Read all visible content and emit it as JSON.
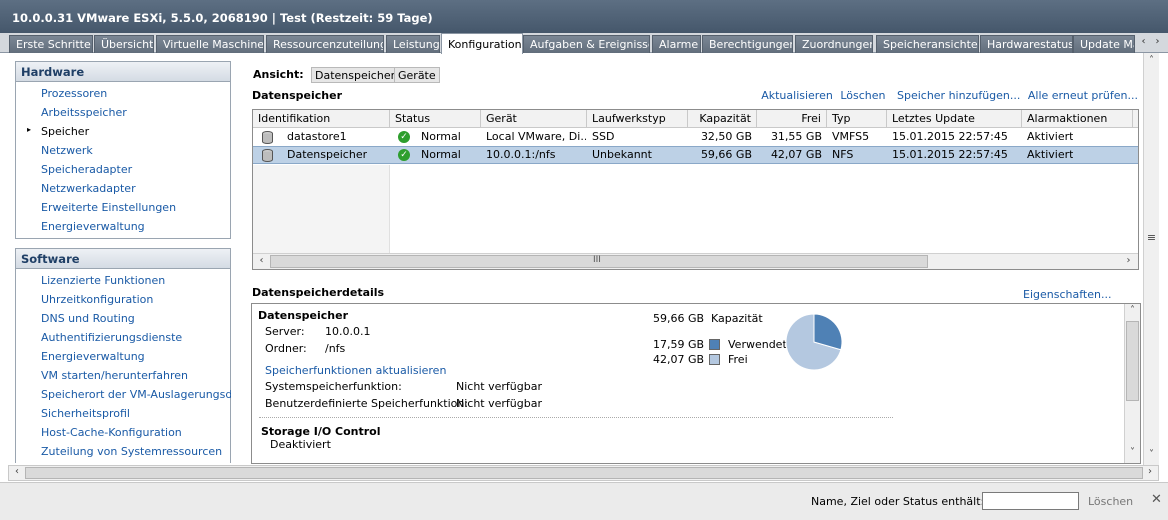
{
  "window": {
    "title": "10.0.0.31 VMware ESXi, 5.5.0, 2068190 | Test (Restzeit: 59 Tage)"
  },
  "tabs": [
    "Erste Schritte",
    "Übersicht",
    "Virtuelle Maschinen",
    "Ressourcenzuteilung",
    "Leistung",
    "Konfiguration",
    "Aufgaben & Ereignisse",
    "Alarme",
    "Berechtigungen",
    "Zuordnungen",
    "Speicheransichten",
    "Hardwarestatus",
    "Update Ma"
  ],
  "tab_nav": {
    "left": "‹",
    "right": "›"
  },
  "hardware": {
    "title": "Hardware",
    "items": [
      "Prozessoren",
      "Arbeitsspeicher",
      "Speicher",
      "Netzwerk",
      "Speicheradapter",
      "Netzwerkadapter",
      "Erweiterte Einstellungen",
      "Energieverwaltung"
    ]
  },
  "software": {
    "title": "Software",
    "items": [
      "Lizenzierte Funktionen",
      "Uhrzeitkonfiguration",
      "DNS und Routing",
      "Authentifizierungsdienste",
      "Energieverwaltung",
      "VM starten/herunterfahren",
      "Speicherort der VM-Auslagerungsdatei",
      "Sicherheitsprofil",
      "Host-Cache-Konfiguration",
      "Zuteilung von Systemressourcen"
    ]
  },
  "view": {
    "label": "Ansicht:",
    "options": [
      "Datenspeicher",
      "Geräte"
    ]
  },
  "datastores": {
    "title": "Datenspeicher",
    "links": [
      "Aktualisieren",
      "Löschen",
      "Speicher hinzufügen...",
      "Alle erneut prüfen..."
    ],
    "columns": [
      "Identifikation",
      "Status",
      "Gerät",
      "Laufwerkstyp",
      "Kapazität",
      "Frei",
      "Typ",
      "Letztes Update",
      "Alarmaktionen"
    ],
    "rows": [
      {
        "id": "datastore1",
        "status": "Normal",
        "device": "Local VMware, Di...",
        "drive": "SSD",
        "capacity": "32,50 GB",
        "free": "31,55 GB",
        "type": "VMFS5",
        "updated": "15.01.2015 22:57:45",
        "alarm": "Aktiviert"
      },
      {
        "id": "Datenspeicher",
        "status": "Normal",
        "device": "10.0.0.1:/nfs",
        "drive": "Unbekannt",
        "capacity": "59,66 GB",
        "free": "42,07 GB",
        "type": "NFS",
        "updated": "15.01.2015 22:57:45",
        "alarm": "Aktiviert"
      }
    ],
    "scroll_center": "III"
  },
  "details": {
    "title": "Datenspeicherdetails",
    "properties_link": "Eigenschaften...",
    "name": "Datenspeicher",
    "server_label": "Server:",
    "server": "10.0.0.1",
    "folder_label": "Ordner:",
    "folder": "/nfs",
    "capacity_value": "59,66 GB",
    "capacity_label": "Kapazität",
    "used_value": "17,59 GB",
    "used_label": "Verwendet",
    "free_value": "42,07 GB",
    "free_label": "Frei",
    "used_color": "#4f81b5",
    "free_color": "#b4c8e0",
    "storage_features_link": "Speicherfunktionen aktualisieren",
    "system_feature_label": "Systemspeicherfunktion:",
    "system_feature": "Nicht verfügbar",
    "user_feature_label": "Benutzerdefinierte Speicherfunktion:",
    "user_feature": "Nicht verfügbar",
    "sioc_title": "Storage I/O Control",
    "sioc_status": "Deaktiviert"
  },
  "status_bar": {
    "filter_label": "Name, Ziel oder Status enthält: ▾",
    "filter_value": "",
    "clear_label": "Löschen",
    "close": "✕"
  }
}
